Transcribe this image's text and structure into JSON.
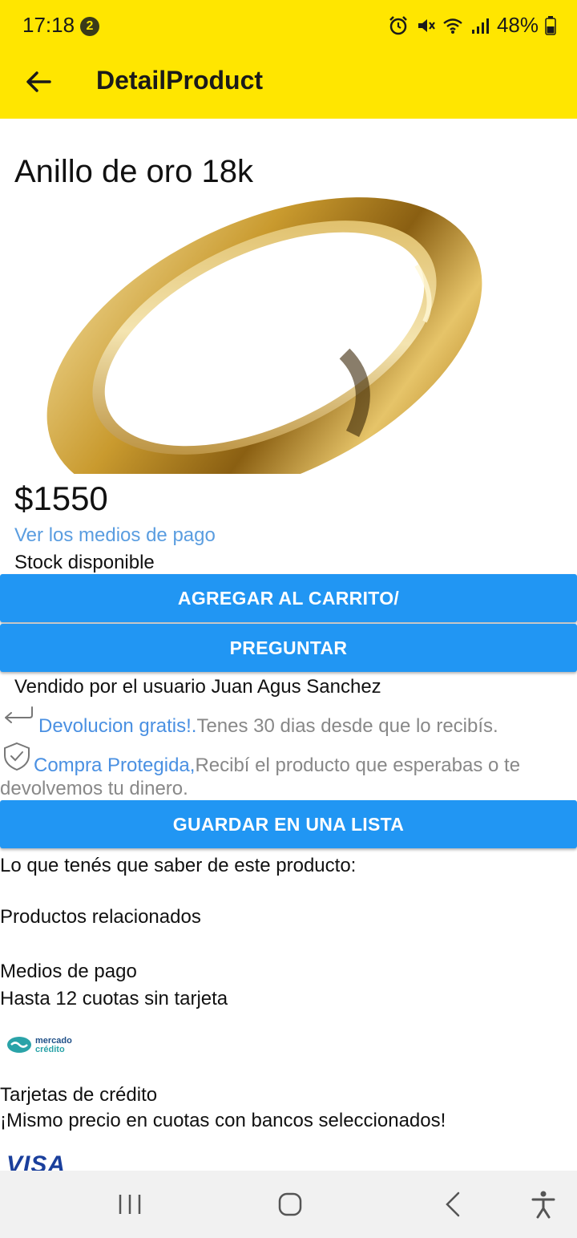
{
  "status_bar": {
    "time": "17:18",
    "notification_count": "2",
    "battery": "48%",
    "icons": [
      "alarm-icon",
      "mute-icon",
      "wifi-icon",
      "signal-icon",
      "battery-icon"
    ]
  },
  "app_bar": {
    "title": "DetailProduct",
    "back_icon": "arrow-left-icon",
    "background": "#ffe600"
  },
  "product": {
    "title": "Anillo de oro 18k",
    "image": "gold-ring-image",
    "price": "$1550",
    "payment_link": "Ver los medios de pago",
    "stock": "Stock disponible"
  },
  "actions": {
    "add_to_cart": "AGREGAR AL CARRITO/",
    "ask": "PREGUNTAR",
    "save_list": "GUARDAR EN UNA LISTA",
    "button_color": "#2196f3"
  },
  "seller": {
    "text": "Vendido por el usuario Juan Agus Sanchez"
  },
  "benefits": {
    "return_highlight": "Devolucion gratis!.",
    "return_text": "Tenes 30 dias desde que lo recibís.",
    "protect_highlight": "Compra Protegida,",
    "protect_text": "Recibí el producto que esperabas o te devolvemos tu dinero."
  },
  "sections": {
    "about": "Lo que tenés que saber de este producto:",
    "related": "Productos relacionados",
    "payment_title": "Medios de pago",
    "payment_quotes": "Hasta 12 cuotas sin tarjeta",
    "mercado_credito_line1": "mercado",
    "mercado_credito_line2": "crédito",
    "cards_title": "Tarjetas de crédito",
    "cards_promo": "¡Mismo precio en cuotas con bancos seleccionados!",
    "visa": "VISA"
  },
  "nav_bar": {
    "icons": [
      "recents-icon",
      "home-icon",
      "back-icon",
      "accessibility-icon"
    ]
  }
}
